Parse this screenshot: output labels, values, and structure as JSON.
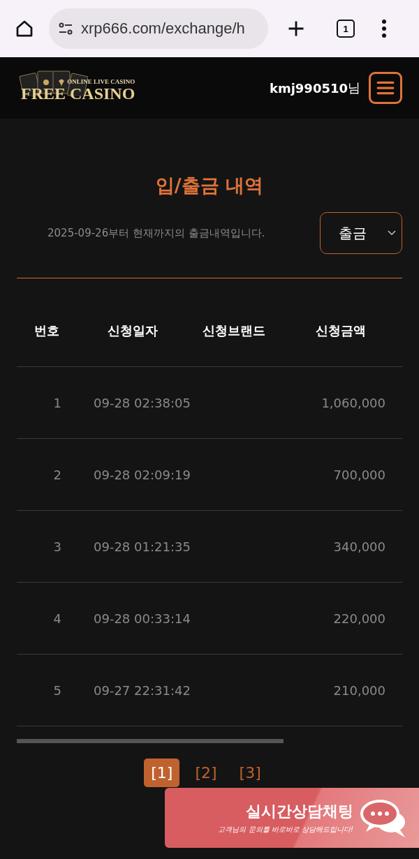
{
  "browser": {
    "url": "xrp666.com/exchange/h",
    "tab_count": "1"
  },
  "header": {
    "logo_tagline": "ONLINE LIVE CASINO",
    "logo_name": "FREE CASINO",
    "username": "kmj990510",
    "honorific": "님"
  },
  "page": {
    "title": "입/출금 내역",
    "description": "2025-09-26부터 현재까지의 출금내역입니다.",
    "filter": {
      "value": "출금"
    }
  },
  "table": {
    "columns": [
      "번호",
      "신청일자",
      "신청브랜드",
      "신청금액"
    ],
    "rows": [
      {
        "number": "1",
        "date": "09-28 02:38:05",
        "brand": "",
        "amount": "1,060,000"
      },
      {
        "number": "2",
        "date": "09-28 02:09:19",
        "brand": "",
        "amount": "700,000"
      },
      {
        "number": "3",
        "date": "09-28 01:21:35",
        "brand": "",
        "amount": "340,000"
      },
      {
        "number": "4",
        "date": "09-28 00:33:14",
        "brand": "",
        "amount": "220,000"
      },
      {
        "number": "5",
        "date": "09-27 22:31:42",
        "brand": "",
        "amount": "210,000"
      }
    ]
  },
  "pagination": [
    {
      "label": "[1]",
      "selected": true
    },
    {
      "label": "[2]",
      "selected": false
    },
    {
      "label": "[3]",
      "selected": false
    }
  ],
  "chat_banner": {
    "title": "실시간상담채팅",
    "subtitle": "고객님의 문의를 바로바로 상담해드립니다!"
  }
}
